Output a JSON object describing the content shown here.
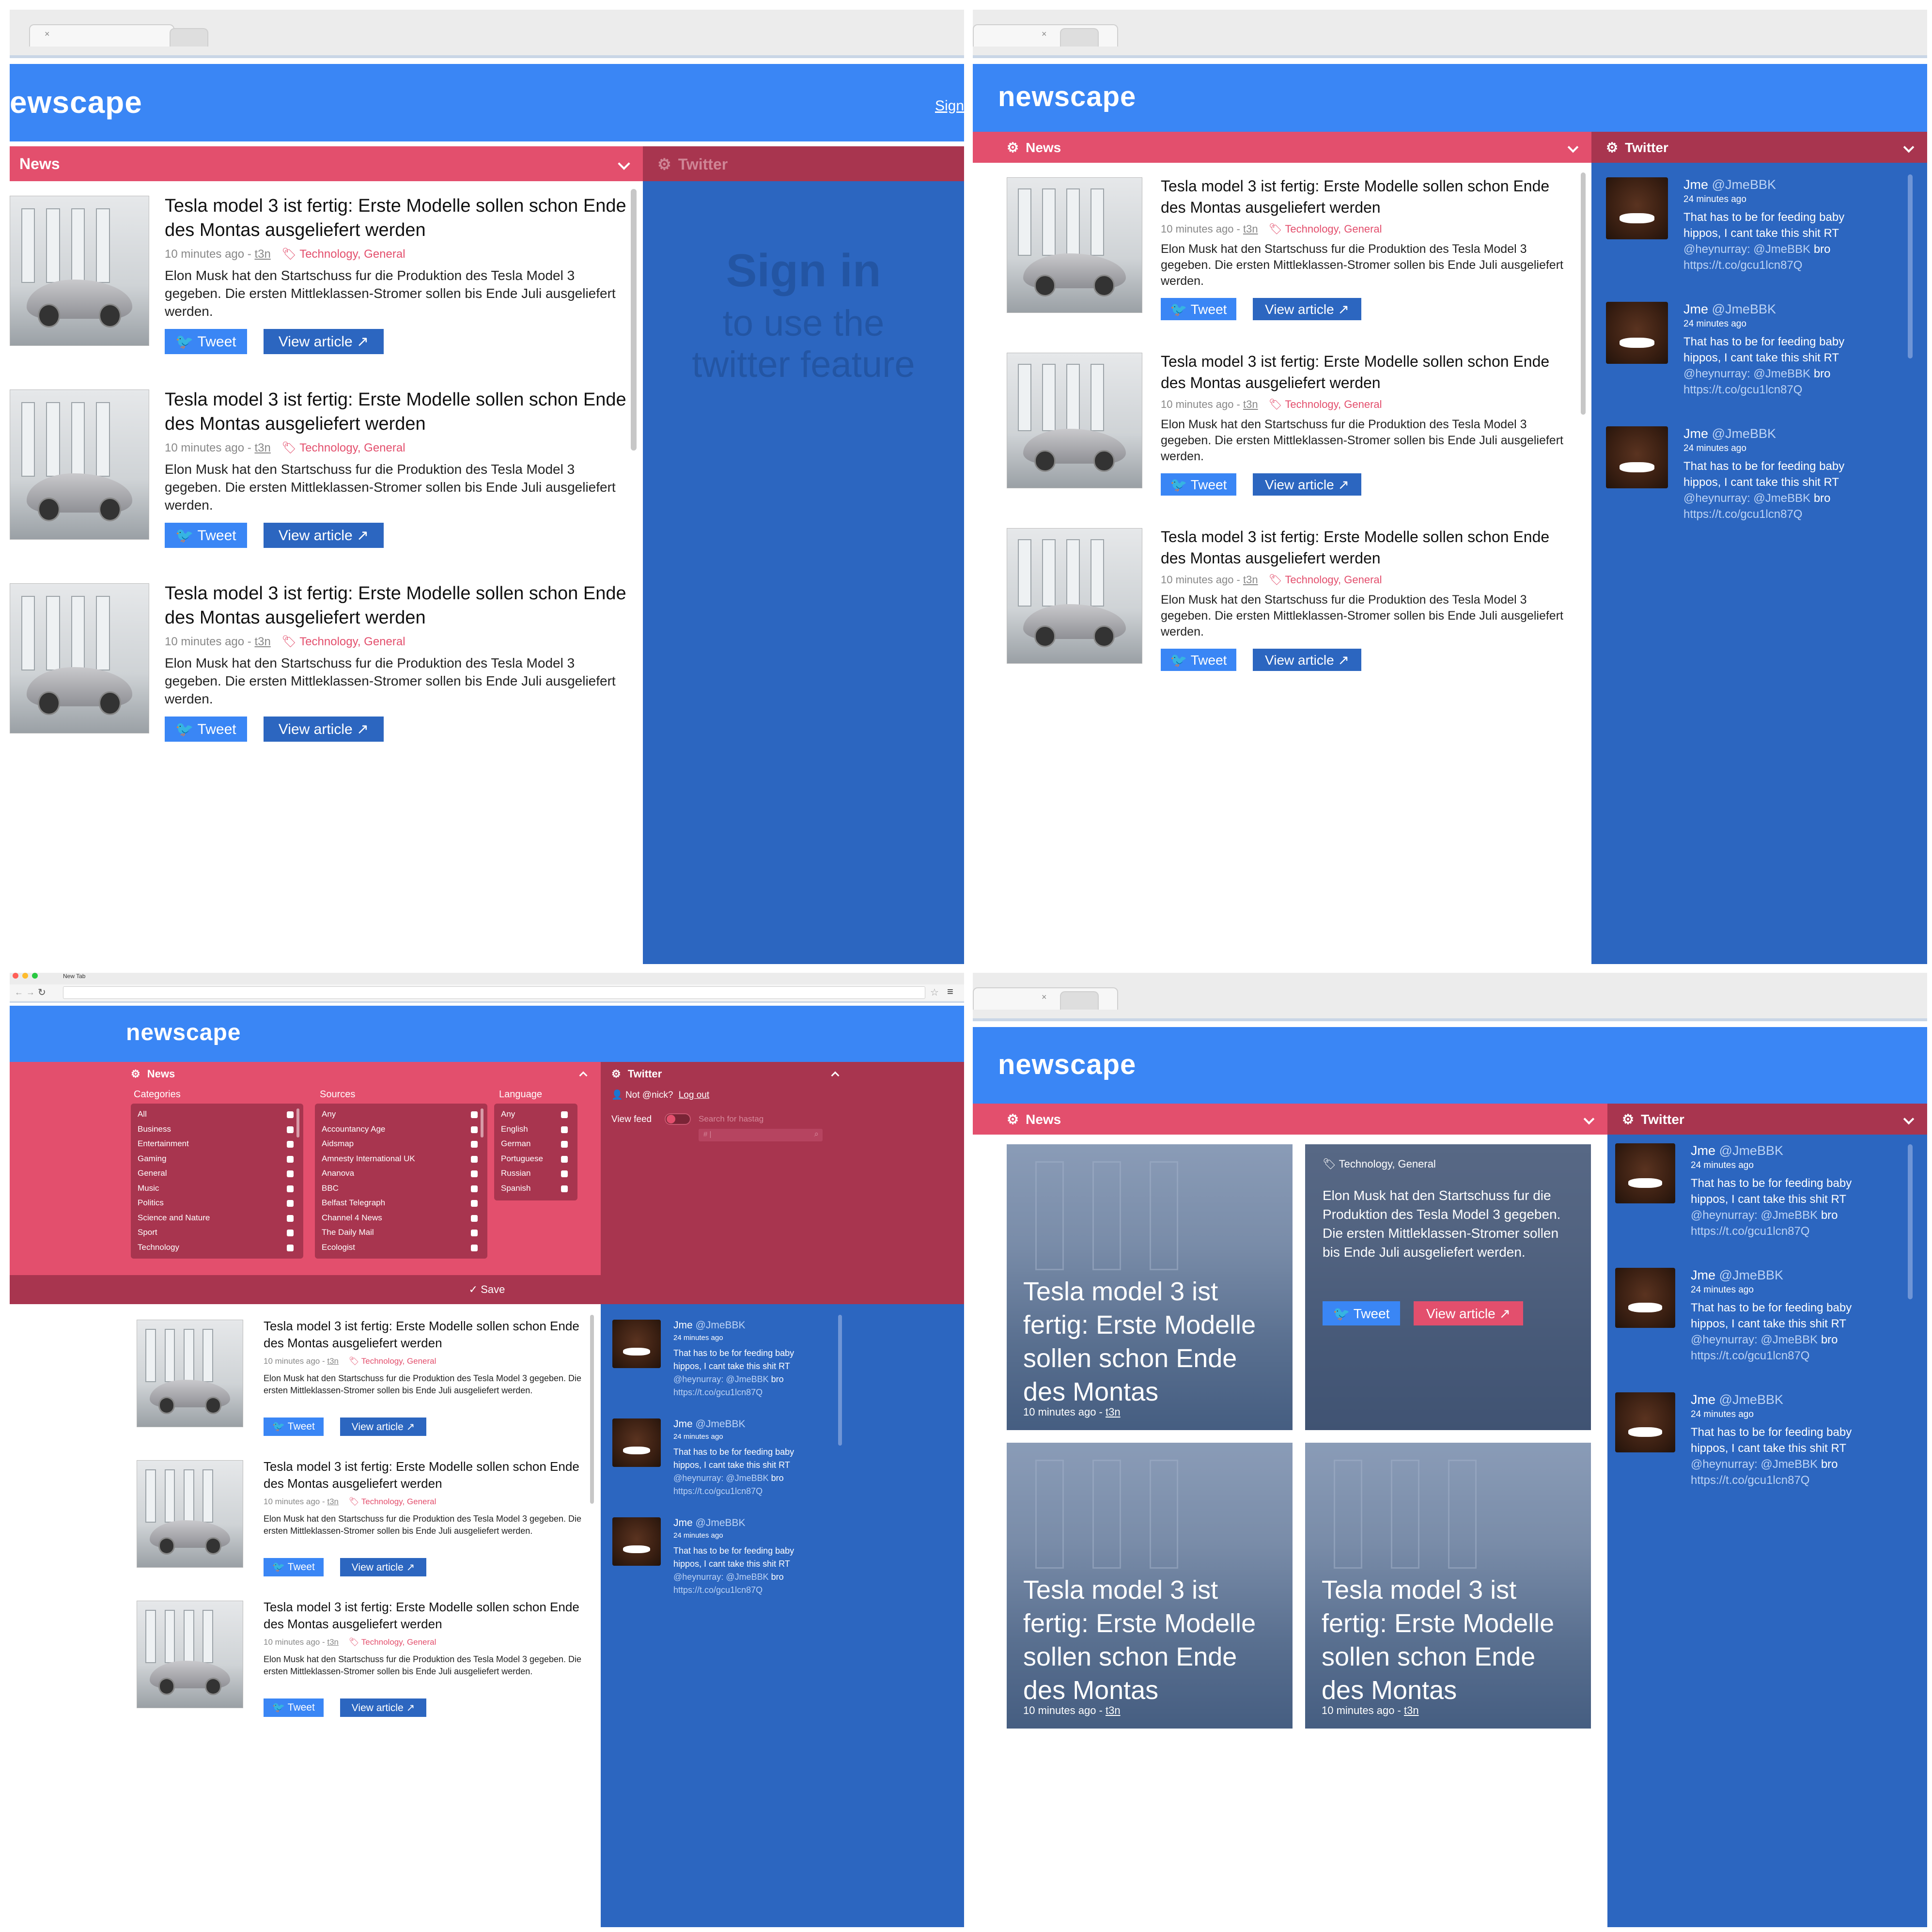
{
  "app": {
    "logo": "newscape",
    "logo_cut": "ewscape",
    "sign_link": "Sign"
  },
  "browser": {
    "tab_title": "New Tab",
    "close": "×"
  },
  "panels": {
    "news": "News",
    "twitter": "Twitter"
  },
  "article": {
    "title": "Tesla model 3 ist fertig: Erste Modelle sollen schon Ende des Montas ausgeliefert werden",
    "time": "10 minutes ago - ",
    "source": "t3n",
    "tags": "Technology, General",
    "text": "Elon Musk hat den Startschuss fur die Produktion des Tesla Model 3 gegeben. Die ersten Mittleklassen-Stromer sollen bis Ende Juli ausgeliefert werden.",
    "tweet_btn": "Tweet",
    "view_btn": "View article"
  },
  "card": {
    "title": "Tesla model 3 ist fertig: Erste Modelle sollen schon Ende des Montas",
    "time": "10 minutes ago - ",
    "source": "t3n"
  },
  "twitter_signin": {
    "title": "Sign in",
    "line1": "to use the",
    "line2": "twitter feature"
  },
  "tweet": {
    "name": "Jme",
    "handle": "@JmeBBK",
    "time": "24 minutes ago",
    "body": "That has to be for feeding baby hippos, I cant take this shit RT",
    "mention": "@heynurray: @JmeBBK",
    "bro": " bro",
    "link": "https://t.co/gcu1lcn87Q"
  },
  "settings": {
    "categories_label": "Categories",
    "sources_label": "Sources",
    "language_label": "Language",
    "categories": [
      "All",
      "Business",
      "Entertainment",
      "Gaming",
      "General",
      "Music",
      "Politics",
      "Science and Nature",
      "Sport",
      "Technology"
    ],
    "sources": [
      "Any",
      "Accountancy Age",
      "Aidsmap",
      "Amnesty International UK",
      "Ananova",
      "BBC",
      "Belfast Telegraph",
      "Channel 4 News",
      "The Daily Mail",
      "Ecologist"
    ],
    "languages": [
      "Any",
      "English",
      "German",
      "Portuguese",
      "Russian",
      "Spanish"
    ],
    "not_nick": "Not @nick?",
    "logout": "Log out",
    "view_feed": "View feed",
    "search_placeholder": "Search for hastag",
    "hash_placeholder": "# |",
    "save": "Save"
  },
  "colors": {
    "header_blue": "#3a86f5",
    "panel_blue": "#2c66c0",
    "news_pink": "#e34f6d",
    "twitter_dark": "#a8354f"
  }
}
